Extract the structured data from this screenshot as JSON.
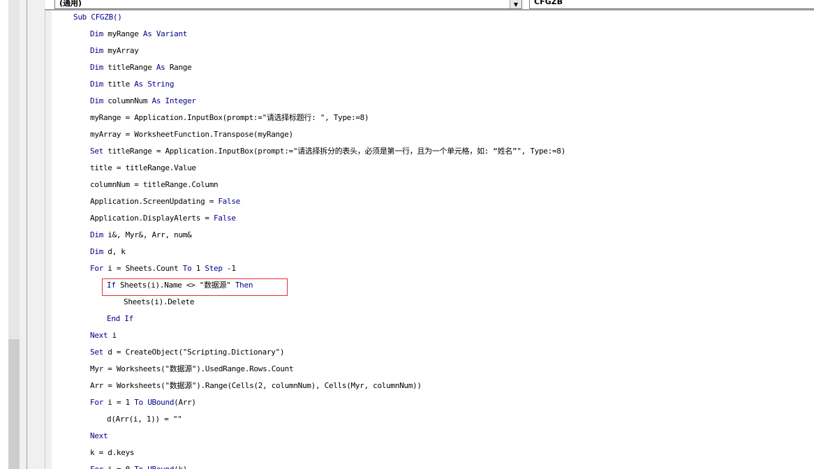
{
  "header": {
    "object_combo": "(通用)",
    "procedure_combo": "CFGZB",
    "dropdown_glyph": "▼"
  },
  "code": {
    "lines": [
      {
        "indent": 0,
        "segments": [
          {
            "t": "Sub CFGZB()",
            "kw": true
          }
        ]
      },
      {
        "indent": 1,
        "segments": [
          {
            "t": "Dim",
            "kw": true
          },
          {
            "t": " myRange ",
            "kw": false
          },
          {
            "t": "As Variant",
            "kw": true
          }
        ]
      },
      {
        "indent": 1,
        "segments": [
          {
            "t": "Dim",
            "kw": true
          },
          {
            "t": " myArray",
            "kw": false
          }
        ]
      },
      {
        "indent": 1,
        "segments": [
          {
            "t": "Dim",
            "kw": true
          },
          {
            "t": " titleRange ",
            "kw": false
          },
          {
            "t": "As",
            "kw": true
          },
          {
            "t": " Range",
            "kw": false
          }
        ]
      },
      {
        "indent": 1,
        "segments": [
          {
            "t": "Dim",
            "kw": true
          },
          {
            "t": " title ",
            "kw": false
          },
          {
            "t": "As String",
            "kw": true
          }
        ]
      },
      {
        "indent": 1,
        "segments": [
          {
            "t": "Dim",
            "kw": true
          },
          {
            "t": " columnNum ",
            "kw": false
          },
          {
            "t": "As Integer",
            "kw": true
          }
        ]
      },
      {
        "indent": 1,
        "segments": [
          {
            "t": "myRange = Application.InputBox(prompt:=\"请选择标题行: \", Type:=8)",
            "kw": false
          }
        ]
      },
      {
        "indent": 1,
        "segments": [
          {
            "t": "myArray = WorksheetFunction.Transpose(myRange)",
            "kw": false
          }
        ]
      },
      {
        "indent": 1,
        "segments": [
          {
            "t": "Set",
            "kw": true
          },
          {
            "t": " titleRange = Application.InputBox(prompt:=\"请选择拆分的表头，必须是第一行，且为一个单元格，如: “姓名”\", Type:=8)",
            "kw": false
          }
        ]
      },
      {
        "indent": 1,
        "segments": [
          {
            "t": "title = titleRange.Value",
            "kw": false
          }
        ]
      },
      {
        "indent": 1,
        "segments": [
          {
            "t": "columnNum = titleRange.Column",
            "kw": false
          }
        ]
      },
      {
        "indent": 1,
        "segments": [
          {
            "t": "Application.ScreenUpdating = ",
            "kw": false
          },
          {
            "t": "False",
            "kw": true
          }
        ]
      },
      {
        "indent": 1,
        "segments": [
          {
            "t": "Application.DisplayAlerts = ",
            "kw": false
          },
          {
            "t": "False",
            "kw": true
          }
        ]
      },
      {
        "indent": 1,
        "segments": [
          {
            "t": "Dim",
            "kw": true
          },
          {
            "t": " i&, Myr&, Arr, num&",
            "kw": false
          }
        ]
      },
      {
        "indent": 1,
        "segments": [
          {
            "t": "Dim",
            "kw": true
          },
          {
            "t": " d, k",
            "kw": false
          }
        ]
      },
      {
        "indent": 1,
        "segments": [
          {
            "t": "For",
            "kw": true
          },
          {
            "t": " i = Sheets.Count ",
            "kw": false
          },
          {
            "t": "To",
            "kw": true
          },
          {
            "t": " 1 ",
            "kw": false
          },
          {
            "t": "Step",
            "kw": true
          },
          {
            "t": " -1",
            "kw": false
          }
        ]
      },
      {
        "indent": 2,
        "segments": [
          {
            "t": "If",
            "kw": true
          },
          {
            "t": " Sheets(i).Name <> \"数据源\" ",
            "kw": false
          },
          {
            "t": "Then",
            "kw": true
          }
        ]
      },
      {
        "indent": 3,
        "segments": [
          {
            "t": "Sheets(i).Delete",
            "kw": false
          }
        ]
      },
      {
        "indent": 2,
        "segments": [
          {
            "t": "End If",
            "kw": true
          }
        ]
      },
      {
        "indent": 1,
        "segments": [
          {
            "t": "Next",
            "kw": true
          },
          {
            "t": " i",
            "kw": false
          }
        ]
      },
      {
        "indent": 1,
        "segments": [
          {
            "t": "Set",
            "kw": true
          },
          {
            "t": " d = CreateObject(\"Scripting.Dictionary\")",
            "kw": false
          }
        ]
      },
      {
        "indent": 1,
        "segments": [
          {
            "t": "Myr = Worksheets(\"数据源\").UsedRange.Rows.Count",
            "kw": false
          }
        ]
      },
      {
        "indent": 1,
        "segments": [
          {
            "t": "Arr = Worksheets(\"数据源\").Range(Cells(2, columnNum), Cells(Myr, columnNum))",
            "kw": false
          }
        ]
      },
      {
        "indent": 1,
        "segments": [
          {
            "t": "For",
            "kw": true
          },
          {
            "t": " i = 1 ",
            "kw": false
          },
          {
            "t": "To UBound",
            "kw": true
          },
          {
            "t": "(Arr)",
            "kw": false
          }
        ]
      },
      {
        "indent": 2,
        "segments": [
          {
            "t": "d(Arr(i, 1)) = \"\"",
            "kw": false
          }
        ]
      },
      {
        "indent": 1,
        "segments": [
          {
            "t": "Next",
            "kw": true
          }
        ]
      },
      {
        "indent": 1,
        "segments": [
          {
            "t": "k = d.keys",
            "kw": false
          }
        ]
      },
      {
        "indent": 1,
        "segments": [
          {
            "t": "For",
            "kw": true
          },
          {
            "t": " i = 0 ",
            "kw": false
          },
          {
            "t": "To UBound",
            "kw": true
          },
          {
            "t": "(k)",
            "kw": false
          }
        ]
      }
    ]
  }
}
